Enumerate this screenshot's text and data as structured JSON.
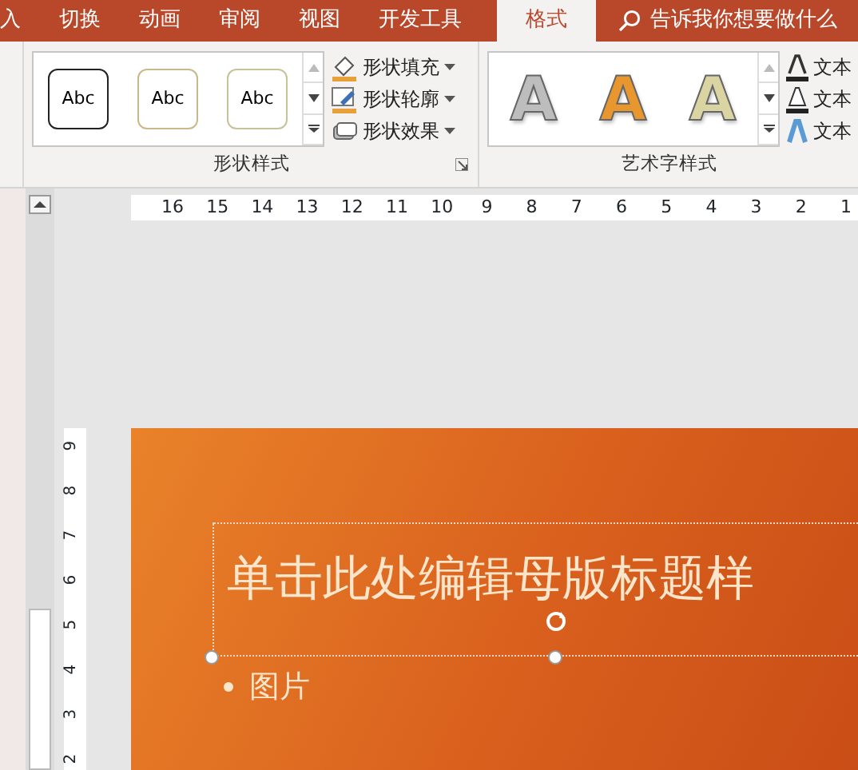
{
  "tabs": [
    {
      "label": "入",
      "selected": false
    },
    {
      "label": "切换",
      "selected": false
    },
    {
      "label": "动画",
      "selected": false
    },
    {
      "label": "审阅",
      "selected": false
    },
    {
      "label": "视图",
      "selected": false
    },
    {
      "label": "开发工具",
      "selected": false
    },
    {
      "label": "格式",
      "selected": true
    }
  ],
  "search": {
    "placeholder": "告诉我你想要做什么"
  },
  "ribbon": {
    "groups": [
      {
        "label": "形状样式",
        "gallery": [
          {
            "label": "Abc",
            "color": "#222222"
          },
          {
            "label": "Abc",
            "color": "#c9b98a"
          },
          {
            "label": "Abc",
            "color": "#c8c29a"
          }
        ],
        "commands": [
          {
            "label": "形状填充",
            "kind": "fill"
          },
          {
            "label": "形状轮廓",
            "kind": "outline"
          },
          {
            "label": "形状效果",
            "kind": "effects"
          }
        ]
      },
      {
        "label": "艺术字样式",
        "gallery": [
          {
            "label": "A",
            "color": "#bdbdbd"
          },
          {
            "label": "A",
            "color": "#e8962e"
          },
          {
            "label": "A",
            "color": "#d9d4a2"
          }
        ],
        "commands": [
          {
            "label": "文本",
            "kind": "fill"
          },
          {
            "label": "文本",
            "kind": "outline"
          },
          {
            "label": "文本",
            "kind": "effects"
          }
        ]
      }
    ]
  },
  "rulers": {
    "horizontal": [
      "16",
      "15",
      "14",
      "13",
      "12",
      "11",
      "10",
      "9",
      "8",
      "7",
      "6",
      "5",
      "4",
      "3",
      "2",
      "1"
    ],
    "vertical": [
      "9",
      "8",
      "7",
      "6",
      "5",
      "4",
      "3",
      "2"
    ]
  },
  "slide": {
    "title": "单击此处编辑母版标题样",
    "bullets": [
      "图片"
    ]
  }
}
